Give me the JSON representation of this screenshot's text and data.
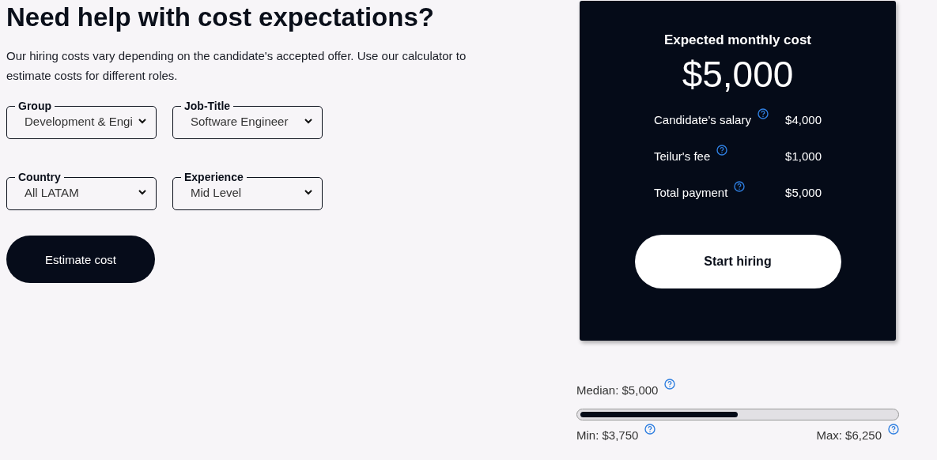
{
  "heading": "Need help with cost expectations?",
  "intro": "Our hiring costs vary depending on the candidate's accepted offer. Use our calculator to estimate costs for different roles.",
  "dropdowns": [
    {
      "label": "Group",
      "value": "Development & Engi"
    },
    {
      "label": "Job-Title",
      "value": "Software Engineer"
    },
    {
      "label": "Country",
      "value": "All LATAM"
    },
    {
      "label": "Experience",
      "value": "Mid Level"
    }
  ],
  "estimate_button": "Estimate cost",
  "cost_card": {
    "title": "Expected monthly cost",
    "amount": "$5,000",
    "lines": [
      {
        "label": "Candidate's salary",
        "value": "$4,000"
      },
      {
        "label": "Teilur's fee",
        "value": "$1,000"
      },
      {
        "label": "Total payment",
        "value": "$5,000"
      }
    ],
    "button": "Start hiring"
  },
  "range": {
    "median": "Median: $5,000",
    "level": 0.5,
    "min": "Min: $3,750",
    "max": "Max: $6,250"
  }
}
